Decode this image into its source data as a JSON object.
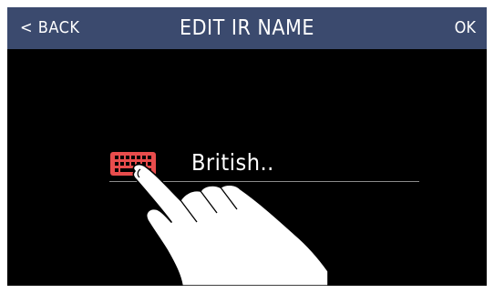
{
  "header": {
    "back_label": "< BACK",
    "title": "EDIT IR NAME",
    "ok_label": "OK"
  },
  "name_field": {
    "value": "British.."
  },
  "icons": {
    "keyboard": "keyboard-icon",
    "hand": "pointing-hand-icon"
  },
  "colors": {
    "header_bg": "#3b4a6e",
    "screen_bg": "#000000",
    "keyboard_icon": "#e84c4c",
    "text": "#ffffff"
  }
}
